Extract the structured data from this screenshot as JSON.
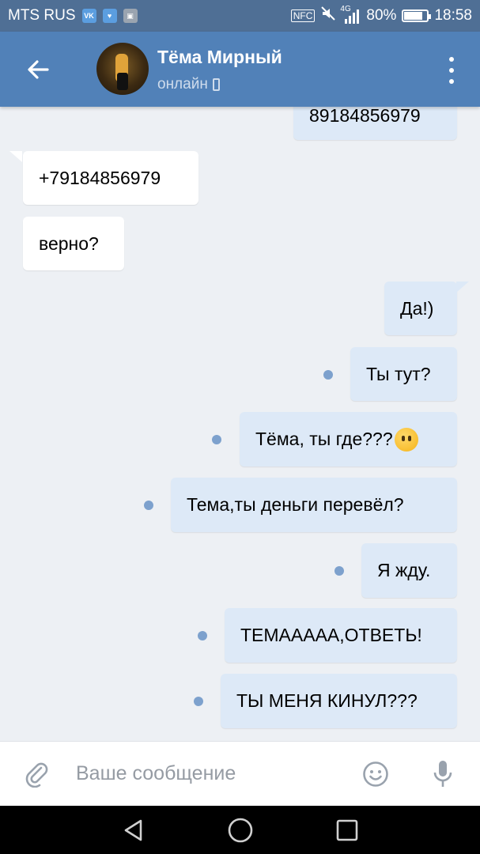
{
  "status_bar": {
    "carrier": "MTS RUS",
    "nfc": "NFC",
    "network": "4G",
    "battery": "80%",
    "battery_level": 0.8,
    "time": "18:58"
  },
  "header": {
    "contact_name": "Тёма Мирный",
    "contact_status": "онлайн",
    "icons": [
      "back-arrow-icon",
      "avatar",
      "phone-icon",
      "more-vert-icon"
    ]
  },
  "messages": [
    {
      "direction": "out",
      "text": "89184856979",
      "unread": false
    },
    {
      "direction": "in",
      "text": "+79184856979",
      "unread": false
    },
    {
      "direction": "in",
      "text": "верно?",
      "unread": false
    },
    {
      "direction": "out",
      "text": "Да!)",
      "unread": false
    },
    {
      "direction": "out",
      "text": "Ты тут?",
      "unread": true
    },
    {
      "direction": "out",
      "text": "Тёма, ты где???",
      "emoji": "face-without-mouth",
      "unread": true
    },
    {
      "direction": "out",
      "text": "Тема,ты деньги перевёл?",
      "unread": true
    },
    {
      "direction": "out",
      "text": "Я жду.",
      "unread": true
    },
    {
      "direction": "out",
      "text": "ТЕМААААА,ОТВЕТЬ!",
      "unread": true
    },
    {
      "direction": "out",
      "text": "ТЫ МЕНЯ КИНУЛ???",
      "unread": true
    }
  ],
  "composer": {
    "placeholder": "Ваше сообщение",
    "value": "",
    "icons": [
      "paperclip-icon",
      "smiley-icon",
      "microphone-icon"
    ]
  },
  "nav_bar": {
    "icons": [
      "nav-back-icon",
      "nav-home-icon",
      "nav-recents-icon"
    ]
  },
  "colors": {
    "status_bar": "#4f6f95",
    "header": "#5181b8",
    "chat_background": "#edf0f4",
    "incoming_bubble": "#ffffff",
    "outgoing_bubble": "#dde9f7",
    "unread_dot": "#7da1cd"
  }
}
